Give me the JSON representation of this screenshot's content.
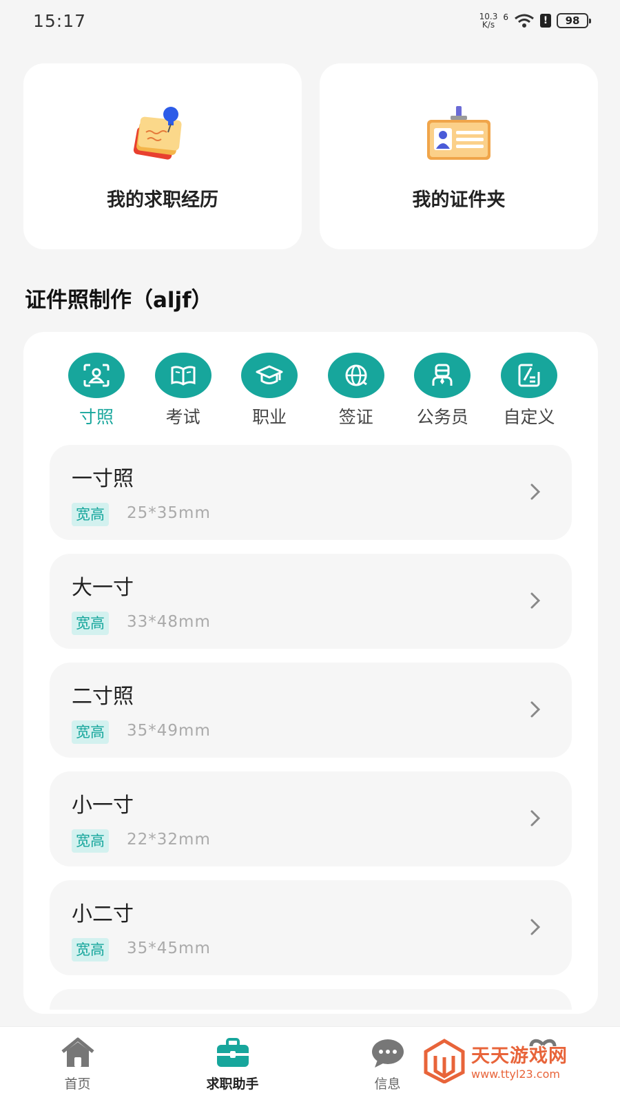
{
  "status_bar": {
    "time": "15:17",
    "net_speed_value": "10.3",
    "net_speed_unit": "K/s",
    "signal_label": "6",
    "battery": "98"
  },
  "top_cards": [
    {
      "label": "我的求职经历",
      "icon": "pinned-notes-icon"
    },
    {
      "label": "我的证件夹",
      "icon": "id-badge-icon"
    }
  ],
  "section_title": "证件照制作（aljf）",
  "categories": [
    {
      "label": "寸照",
      "icon": "portrait-frame-icon",
      "active": true
    },
    {
      "label": "考试",
      "icon": "open-book-icon",
      "active": false
    },
    {
      "label": "职业",
      "icon": "graduation-cap-icon",
      "active": false
    },
    {
      "label": "签证",
      "icon": "globe-icon",
      "active": false
    },
    {
      "label": "公务员",
      "icon": "officer-icon",
      "active": false
    },
    {
      "label": "自定义",
      "icon": "edit-icon",
      "active": false
    }
  ],
  "sizes": [
    {
      "title": "一寸照",
      "tag": "宽高",
      "size": "25*35mm"
    },
    {
      "title": "大一寸",
      "tag": "宽高",
      "size": "33*48mm"
    },
    {
      "title": "二寸照",
      "tag": "宽高",
      "size": "35*49mm"
    },
    {
      "title": "小一寸",
      "tag": "宽高",
      "size": "22*32mm"
    },
    {
      "title": "小二寸",
      "tag": "宽高",
      "size": "35*45mm"
    }
  ],
  "bottom_nav": [
    {
      "label": "首页",
      "icon": "home-icon",
      "active": false
    },
    {
      "label": "求职助手",
      "icon": "briefcase-icon",
      "active": true
    },
    {
      "label": "信息",
      "icon": "chat-bubble-icon",
      "active": false
    },
    {
      "label": "",
      "icon": "heart-icon",
      "active": false
    }
  ],
  "watermark": {
    "name": "天天游戏网",
    "url": "www.ttyl23.com"
  },
  "colors": {
    "accent": "#17a69c",
    "tag_bg": "#d3f1ef",
    "background": "#f5f5f5",
    "watermark": "#e8643a"
  }
}
